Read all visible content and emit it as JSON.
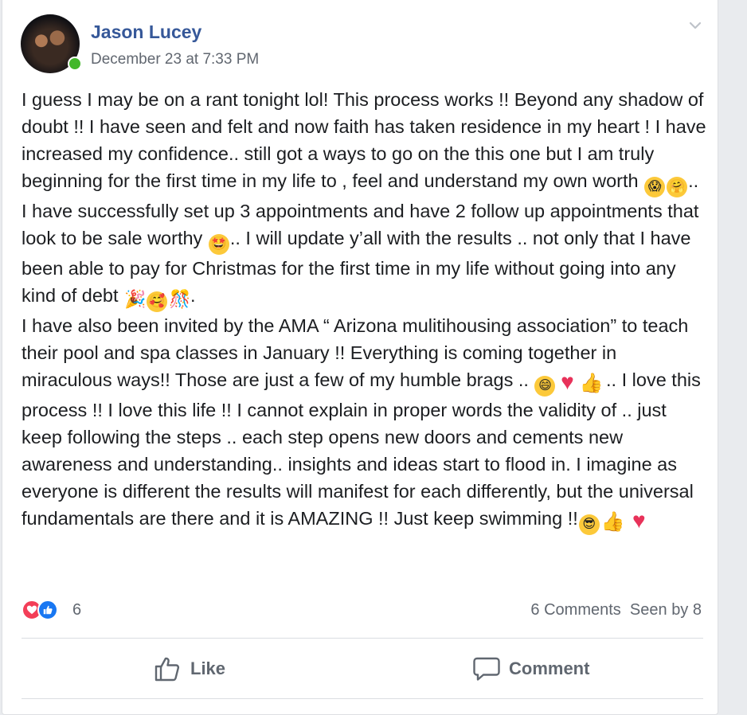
{
  "post": {
    "author": "Jason Lucey",
    "timestamp": "December 23 at 7:33 PM",
    "paragraphs": [
      "I guess I may be on a rant tonight lol! This process works !! Beyond any shadow of doubt !! I have seen and felt and now faith has taken residence in my heart ! I have increased my confidence.. still got a ways to go on the this one but I am truly beginning for the first time in my life to , feel and understand my own worth",
      "I have successfully set up 3 appointments and have 2 follow up appointments that look to be sale worthy",
      ".. I will update y’all with the results .. not only that I have been able to pay for Christmas for the first time in my life without going into any kind of debt",
      "I have also been invited by the AMA “ Arizona mulitihousing association” to teach their pool and spa classes in January !! Everything is coming together in miraculous ways!! Those are just a few of my humble brags ..",
      ".. I love this process !! I love this life !! I cannot explain in proper words the validity of .. just keep following the steps .. each step opens new doors and cements new awareness and understanding.. insights and ideas start to flood in. I imagine as everyone is different the results will manifest for each differently, but the universal fundamentals are there and it is AMAZING !! Just keep swimming !!"
    ],
    "punct": {
      "after_worth": "..",
      "after_debt": "."
    },
    "emojis": {
      "worth": [
        "scream-emoji",
        "hug-emoji"
      ],
      "sale": [
        "star-struck-emoji"
      ],
      "debt": [
        "party-popper-emoji",
        "smiling-face-hearts-emoji",
        "confetti-emoji"
      ],
      "brags": [
        "grinning-emoji",
        "red-heart-emoji",
        "thumbs-up-emoji"
      ],
      "end": [
        "sunglasses-emoji",
        "thumbs-up-emoji",
        "red-heart-emoji"
      ]
    }
  },
  "reactions": {
    "icons": [
      "love-reaction-icon",
      "like-reaction-icon"
    ],
    "count": "6"
  },
  "stats": {
    "comments": "6 Comments",
    "seen": "Seen by 8"
  },
  "actions": {
    "like_label": "Like",
    "comment_label": "Comment"
  },
  "colors": {
    "author_link": "#365899",
    "online": "#42b72a",
    "love": "#f33e58",
    "like": "#1877f2"
  }
}
